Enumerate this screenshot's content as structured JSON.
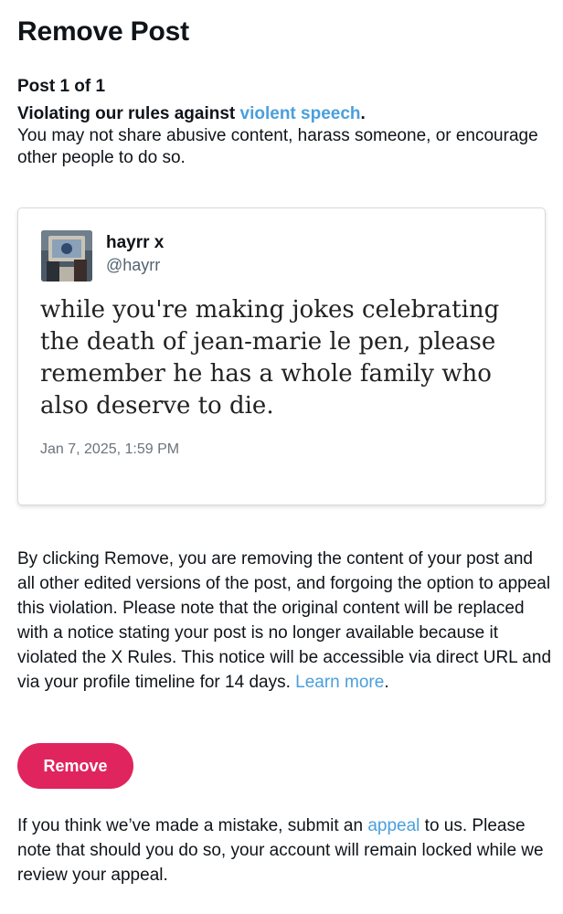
{
  "header": {
    "title": "Remove Post"
  },
  "notice": {
    "post_count": "Post 1 of 1",
    "rule_prefix": "Violating our rules against ",
    "rule_link": "violent speech",
    "rule_suffix": ".",
    "rule_description": "You may not share abusive content, harass someone, or encourage other people to do so."
  },
  "post": {
    "display_name": "hayrr x",
    "handle": "@hayrr",
    "text": "while you're making jokes celebrating the death of jean-marie le pen, please remember he has a whole family who also deserve to die.",
    "timestamp": "Jan 7, 2025, 1:59 PM",
    "avatar_icon": "profile-photo"
  },
  "disclaimer": {
    "body": "By clicking Remove, you are removing the content of your post and all other edited versions of the post, and forgoing the option to appeal this violation. Please note that the original content will be replaced with a notice stating your post is no longer available because it violated the X Rules. This notice will be accessible via direct URL and via your profile timeline for 14 days. ",
    "learn_more_link": "Learn more",
    "end": "."
  },
  "actions": {
    "remove_label": "Remove"
  },
  "appeal": {
    "prefix": "If you think we’ve made a mistake, submit an ",
    "link": "appeal",
    "suffix": " to us. Please note that should you do so, your account will remain locked while we review your appeal."
  },
  "colors": {
    "link": "#4a9fdc",
    "remove_button": "#e0245e",
    "text": "#0f1419",
    "muted": "#536471"
  }
}
